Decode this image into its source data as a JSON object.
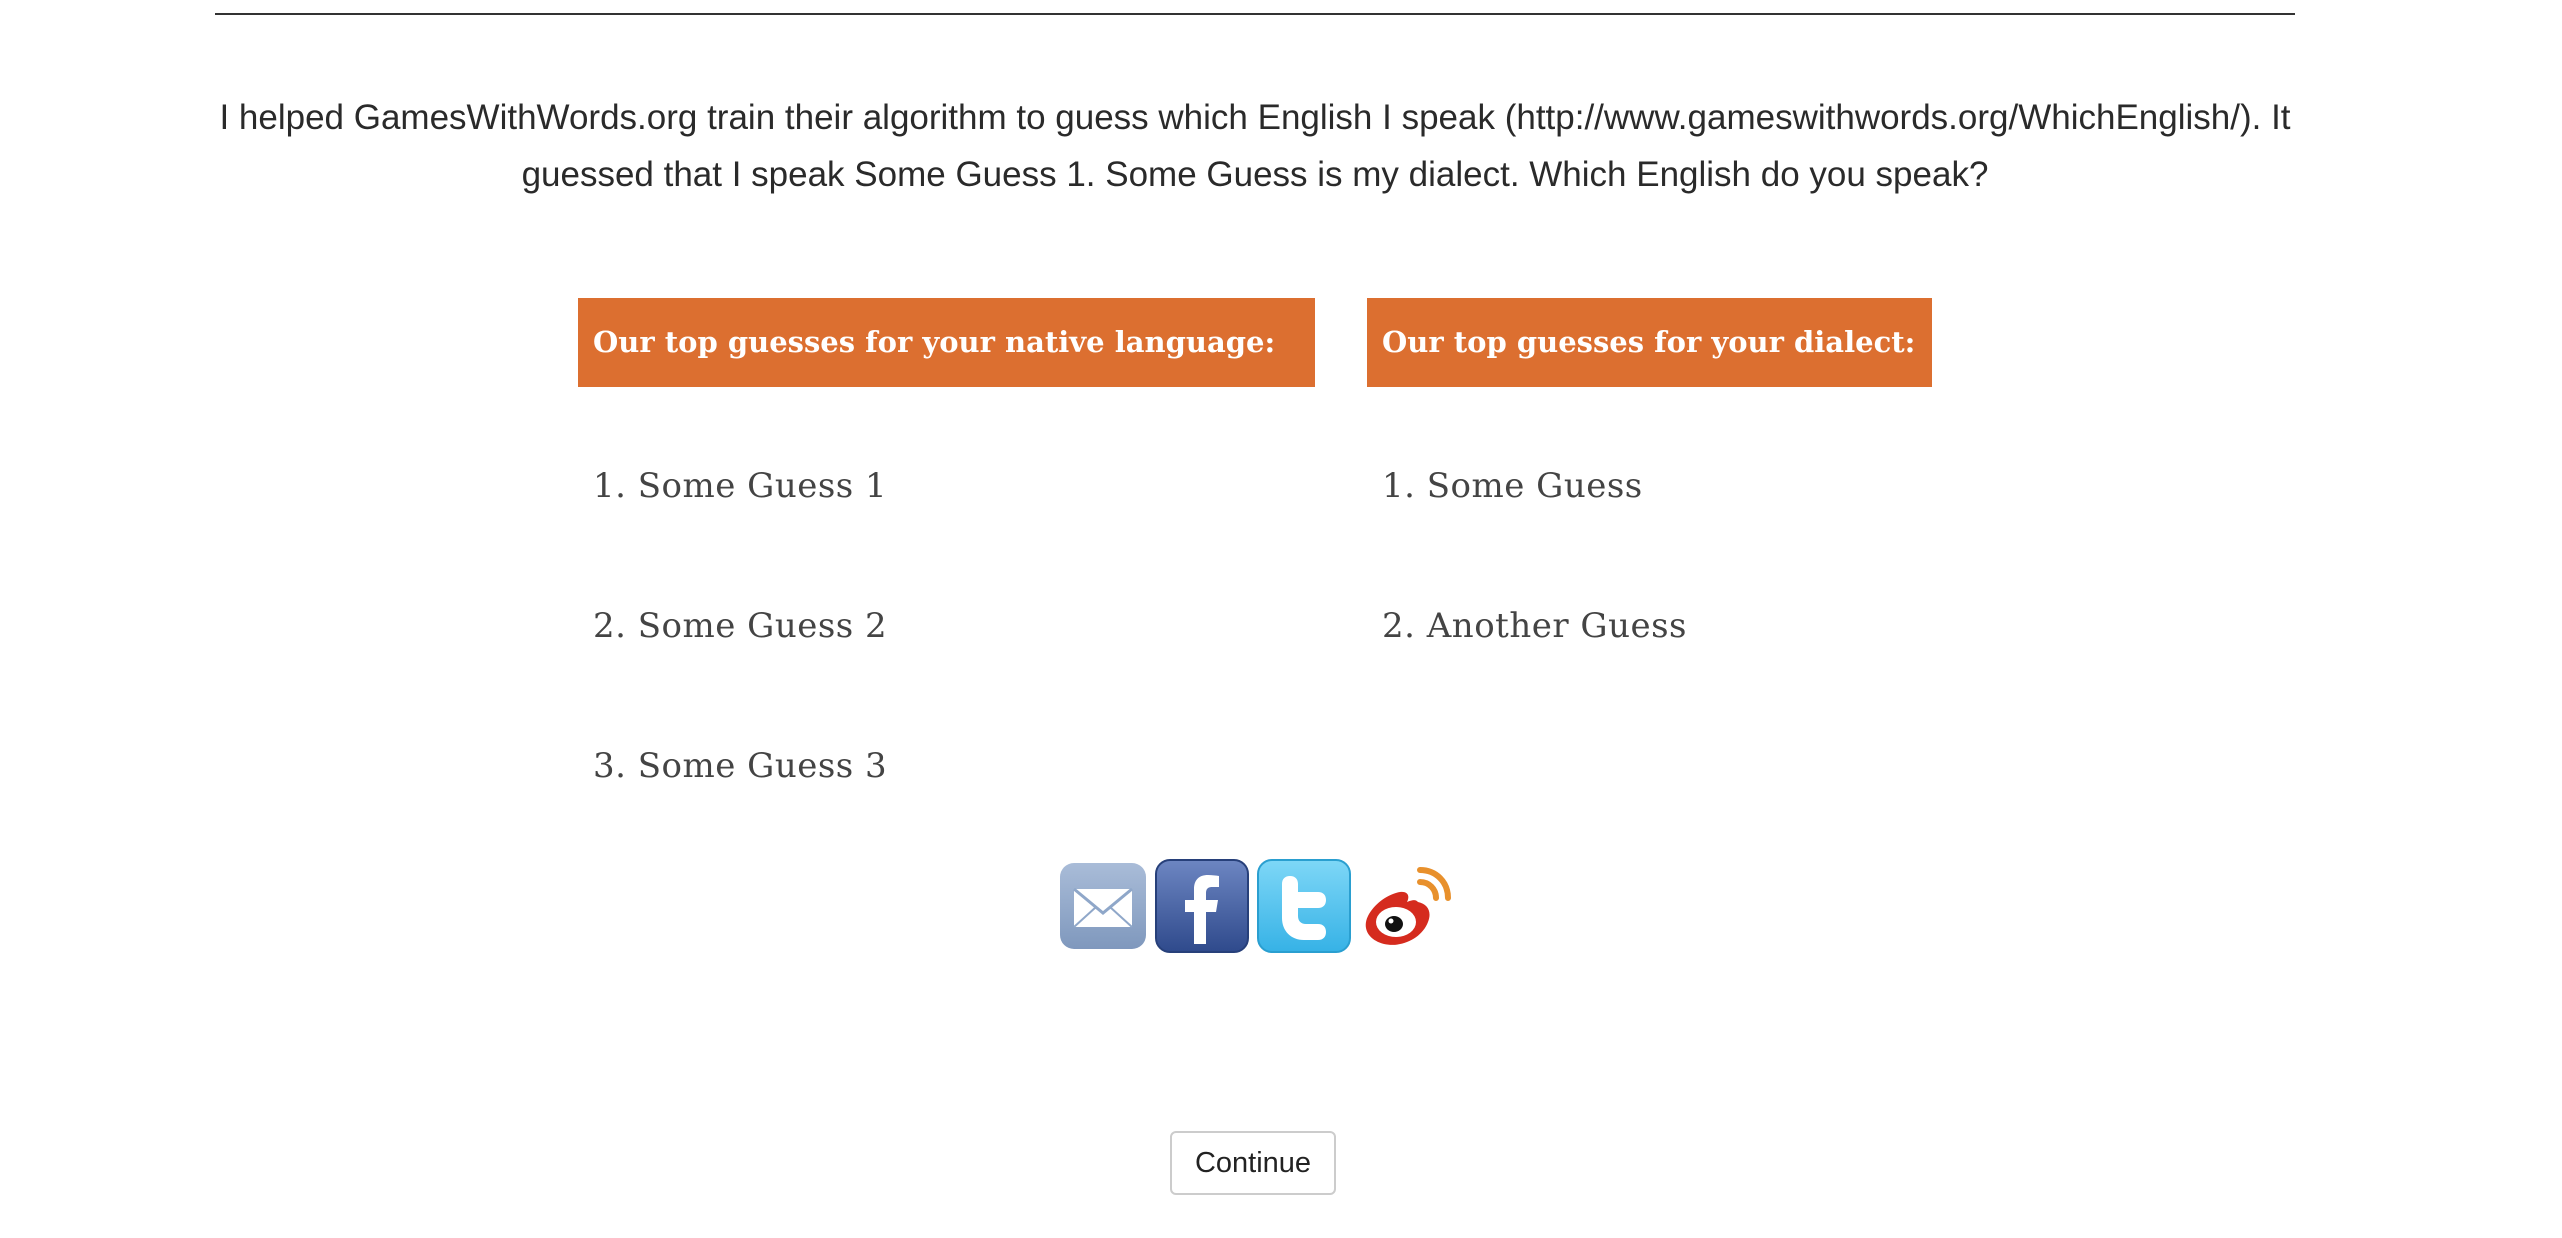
{
  "intro_text": "I helped GamesWithWords.org train their algorithm to guess which English I speak (http://www.gameswithwords.org/WhichEnglish/). It guessed that I speak Some Guess 1. Some Guess is my dialect. Which English do you speak?",
  "native_language": {
    "header": "Our top guesses for your native language:",
    "guesses": [
      "1. Some Guess 1",
      "2. Some Guess 2",
      "3. Some Guess 3"
    ]
  },
  "dialect": {
    "header": "Our top guesses for your dialect:",
    "guesses": [
      "1. Some Guess",
      "2. Another Guess"
    ]
  },
  "share": {
    "icons": [
      "email-icon",
      "facebook-icon",
      "twitter-icon",
      "weibo-icon"
    ]
  },
  "continue_label": "Continue",
  "colors": {
    "header_bg": "#dc6f30",
    "header_text": "#ffffff",
    "email": "#8fa7c9",
    "facebook": "#3b5998",
    "twitter": "#4fc3f0",
    "weibo": "#d52b1e"
  }
}
